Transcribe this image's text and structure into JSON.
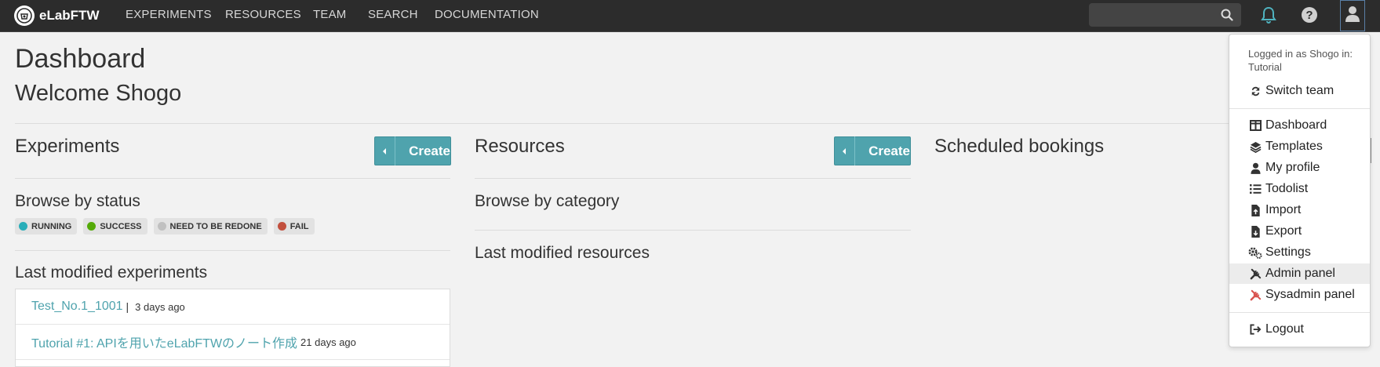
{
  "nav": {
    "brand": "eLabFTW",
    "links": [
      "EXPERIMENTS",
      "RESOURCES",
      "TEAM",
      "SEARCH",
      "DOCUMENTATION"
    ],
    "search_value": "",
    "icons": [
      "search-icon",
      "bell-icon",
      "help-icon",
      "user-icon"
    ]
  },
  "dashboard": {
    "title": "Dashboard",
    "welcome": "Welcome Shogo"
  },
  "experiments": {
    "title": "Experiments",
    "create_label": "Create",
    "browse_title": "Browse by status",
    "statuses": [
      {
        "label": "RUNNING",
        "color": "#29aeb9"
      },
      {
        "label": "SUCCESS",
        "color": "#54aa08"
      },
      {
        "label": "NEED TO BE REDONE",
        "color": "#c0c0c0"
      },
      {
        "label": "FAIL",
        "color": "#c24f3d"
      }
    ],
    "last_modified_title": "Last modified experiments",
    "items": [
      {
        "title": "Test_No.1_1001",
        "separator": "|",
        "ago": "3 days ago"
      },
      {
        "title": "Tutorial #1: APIを用いたeLabFTWのノート作成",
        "ago": "21 days ago"
      }
    ]
  },
  "resources": {
    "title": "Resources",
    "create_label": "Create",
    "browse_title": "Browse by category",
    "last_modified_title": "Last modified resources"
  },
  "bookings": {
    "title": "Scheduled bookings"
  },
  "user_menu": {
    "logged_in_as": "Logged in as Shogo in:",
    "team": "Tutorial",
    "switch_team": "Switch team",
    "items": [
      {
        "label": "Dashboard",
        "icon": "columns-icon"
      },
      {
        "label": "Templates",
        "icon": "layers-icon"
      },
      {
        "label": "My profile",
        "icon": "user-icon"
      },
      {
        "label": "Todolist",
        "icon": "list-icon"
      },
      {
        "label": "Import",
        "icon": "file-import-icon"
      },
      {
        "label": "Export",
        "icon": "file-export-icon"
      },
      {
        "label": "Settings",
        "icon": "gears-icon"
      },
      {
        "label": "Admin panel",
        "icon": "tools-icon"
      },
      {
        "label": "Sysadmin panel",
        "icon": "tools-red-icon"
      }
    ],
    "logout": "Logout",
    "colors": {
      "sysadmin_icon": "#d9534f",
      "accent": "#4fa3ad"
    }
  }
}
